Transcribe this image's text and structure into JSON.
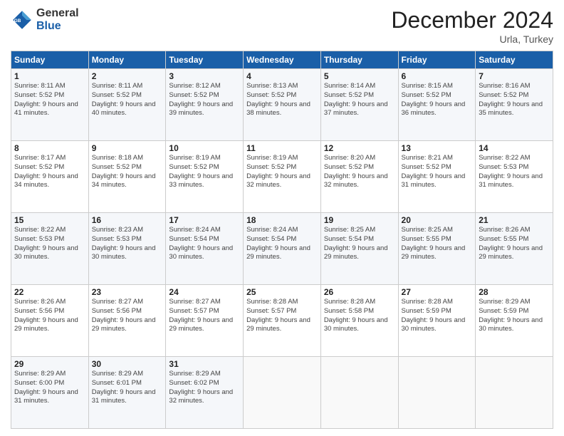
{
  "header": {
    "logo_line1": "General",
    "logo_line2": "Blue",
    "month": "December 2024",
    "location": "Urla, Turkey"
  },
  "weekdays": [
    "Sunday",
    "Monday",
    "Tuesday",
    "Wednesday",
    "Thursday",
    "Friday",
    "Saturday"
  ],
  "weeks": [
    [
      {
        "day": "1",
        "rise": "8:11 AM",
        "set": "5:52 PM",
        "hours": "9 hours and 41 minutes."
      },
      {
        "day": "2",
        "rise": "8:11 AM",
        "set": "5:52 PM",
        "hours": "9 hours and 40 minutes."
      },
      {
        "day": "3",
        "rise": "8:12 AM",
        "set": "5:52 PM",
        "hours": "9 hours and 39 minutes."
      },
      {
        "day": "4",
        "rise": "8:13 AM",
        "set": "5:52 PM",
        "hours": "9 hours and 38 minutes."
      },
      {
        "day": "5",
        "rise": "8:14 AM",
        "set": "5:52 PM",
        "hours": "9 hours and 37 minutes."
      },
      {
        "day": "6",
        "rise": "8:15 AM",
        "set": "5:52 PM",
        "hours": "9 hours and 36 minutes."
      },
      {
        "day": "7",
        "rise": "8:16 AM",
        "set": "5:52 PM",
        "hours": "9 hours and 35 minutes."
      }
    ],
    [
      {
        "day": "8",
        "rise": "8:17 AM",
        "set": "5:52 PM",
        "hours": "9 hours and 34 minutes."
      },
      {
        "day": "9",
        "rise": "8:18 AM",
        "set": "5:52 PM",
        "hours": "9 hours and 34 minutes."
      },
      {
        "day": "10",
        "rise": "8:19 AM",
        "set": "5:52 PM",
        "hours": "9 hours and 33 minutes."
      },
      {
        "day": "11",
        "rise": "8:19 AM",
        "set": "5:52 PM",
        "hours": "9 hours and 32 minutes."
      },
      {
        "day": "12",
        "rise": "8:20 AM",
        "set": "5:52 PM",
        "hours": "9 hours and 32 minutes."
      },
      {
        "day": "13",
        "rise": "8:21 AM",
        "set": "5:52 PM",
        "hours": "9 hours and 31 minutes."
      },
      {
        "day": "14",
        "rise": "8:22 AM",
        "set": "5:53 PM",
        "hours": "9 hours and 31 minutes."
      }
    ],
    [
      {
        "day": "15",
        "rise": "8:22 AM",
        "set": "5:53 PM",
        "hours": "9 hours and 30 minutes."
      },
      {
        "day": "16",
        "rise": "8:23 AM",
        "set": "5:53 PM",
        "hours": "9 hours and 30 minutes."
      },
      {
        "day": "17",
        "rise": "8:24 AM",
        "set": "5:54 PM",
        "hours": "9 hours and 30 minutes."
      },
      {
        "day": "18",
        "rise": "8:24 AM",
        "set": "5:54 PM",
        "hours": "9 hours and 29 minutes."
      },
      {
        "day": "19",
        "rise": "8:25 AM",
        "set": "5:54 PM",
        "hours": "9 hours and 29 minutes."
      },
      {
        "day": "20",
        "rise": "8:25 AM",
        "set": "5:55 PM",
        "hours": "9 hours and 29 minutes."
      },
      {
        "day": "21",
        "rise": "8:26 AM",
        "set": "5:55 PM",
        "hours": "9 hours and 29 minutes."
      }
    ],
    [
      {
        "day": "22",
        "rise": "8:26 AM",
        "set": "5:56 PM",
        "hours": "9 hours and 29 minutes."
      },
      {
        "day": "23",
        "rise": "8:27 AM",
        "set": "5:56 PM",
        "hours": "9 hours and 29 minutes."
      },
      {
        "day": "24",
        "rise": "8:27 AM",
        "set": "5:57 PM",
        "hours": "9 hours and 29 minutes."
      },
      {
        "day": "25",
        "rise": "8:28 AM",
        "set": "5:57 PM",
        "hours": "9 hours and 29 minutes."
      },
      {
        "day": "26",
        "rise": "8:28 AM",
        "set": "5:58 PM",
        "hours": "9 hours and 30 minutes."
      },
      {
        "day": "27",
        "rise": "8:28 AM",
        "set": "5:59 PM",
        "hours": "9 hours and 30 minutes."
      },
      {
        "day": "28",
        "rise": "8:29 AM",
        "set": "5:59 PM",
        "hours": "9 hours and 30 minutes."
      }
    ],
    [
      {
        "day": "29",
        "rise": "8:29 AM",
        "set": "6:00 PM",
        "hours": "9 hours and 31 minutes."
      },
      {
        "day": "30",
        "rise": "8:29 AM",
        "set": "6:01 PM",
        "hours": "9 hours and 31 minutes."
      },
      {
        "day": "31",
        "rise": "8:29 AM",
        "set": "6:02 PM",
        "hours": "9 hours and 32 minutes."
      },
      null,
      null,
      null,
      null
    ]
  ]
}
